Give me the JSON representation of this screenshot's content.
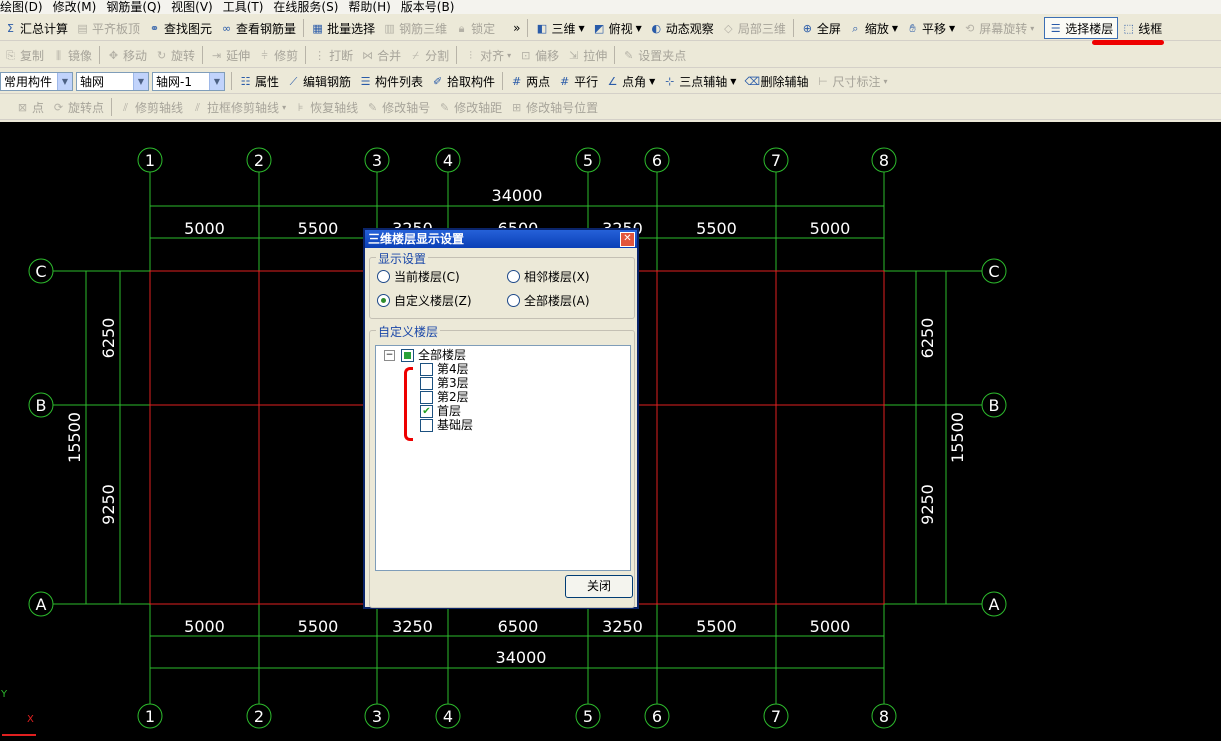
{
  "menu": [
    "绘图(D)",
    "修改(M)",
    "钢筋量(Q)",
    "视图(V)",
    "工具(T)",
    "在线服务(S)",
    "帮助(H)",
    "版本号(B)"
  ],
  "toolbar1": {
    "summary": "汇总计算",
    "flush_top": "平齐板顶",
    "find": "查找图元",
    "view_rebar": "查看钢筋量",
    "batch_select": "批量选择",
    "rebar_3d": "钢筋三维",
    "lock": "锁定",
    "more": "»",
    "view_3d": "三维",
    "top_view": "俯视",
    "dynamic": "动态观察",
    "local_3d": "局部三维",
    "fullscreen": "全屏",
    "zoom": "缩放",
    "pan": "平移",
    "rotate": "屏幕旋转",
    "select_floor": "选择楼层",
    "wireframe": "线框"
  },
  "toolbar2": [
    "复制",
    "镜像",
    "移动",
    "旋转",
    "延伸",
    "修剪",
    "打断",
    "合并",
    "分割",
    "对齐",
    "偏移",
    "拉伸",
    "设置夹点"
  ],
  "toolbar3": {
    "combo1": "常用构件",
    "combo2": "轴网",
    "combo3": "轴网-1",
    "props": "属性",
    "edit_rebar": "编辑钢筋",
    "comp_list": "构件列表",
    "pick": "拾取构件",
    "two_point": "两点",
    "parallel": "平行",
    "point_angle": "点角",
    "three_point": "三点辅轴",
    "del_aux": "删除辅轴",
    "dim": "尺寸标注"
  },
  "toolbar4": [
    "点",
    "旋转点",
    "修剪轴线",
    "拉框修剪轴线",
    "恢复轴线",
    "修改轴号",
    "修改轴距",
    "修改轴号位置"
  ],
  "grid": {
    "col_labels": [
      "1",
      "2",
      "3",
      "4",
      "5",
      "6",
      "7",
      "8"
    ],
    "row_labels": [
      "C",
      "B",
      "A"
    ],
    "top_total": "34000",
    "top_spans": [
      "5000",
      "5500",
      "3250",
      "6500",
      "3250",
      "5500",
      "5000"
    ],
    "bottom_total": "34000",
    "bottom_spans": [
      "5000",
      "5500",
      "3250",
      "6500",
      "3250",
      "5500",
      "5000"
    ],
    "left_spans": [
      "6250",
      "9250"
    ],
    "left_total": "15500",
    "right_spans": [
      "6250",
      "9250"
    ],
    "right_total": "15500",
    "axis_y": "Y",
    "axis_x": "X"
  },
  "dialog": {
    "title": "三维楼层显示设置",
    "display_group": "显示设置",
    "opt_current": "当前楼层(C)",
    "opt_adjacent": "相邻楼层(X)",
    "opt_custom": "自定义楼层(Z)",
    "opt_all": "全部楼层(A)",
    "selected_option": "自定义楼层(Z)",
    "custom_group": "自定义楼层",
    "tree_root": "全部楼层",
    "floors": [
      {
        "label": "第4层",
        "checked": false
      },
      {
        "label": "第3层",
        "checked": false
      },
      {
        "label": "第2层",
        "checked": false
      },
      {
        "label": "首层",
        "checked": true
      },
      {
        "label": "基础层",
        "checked": false
      }
    ],
    "close": "关闭"
  },
  "colors": {
    "grid_line": "#2dbb2d",
    "beam_line": "#e02020",
    "dim_line": "#2dbb2d",
    "highlight": "#e00000"
  }
}
